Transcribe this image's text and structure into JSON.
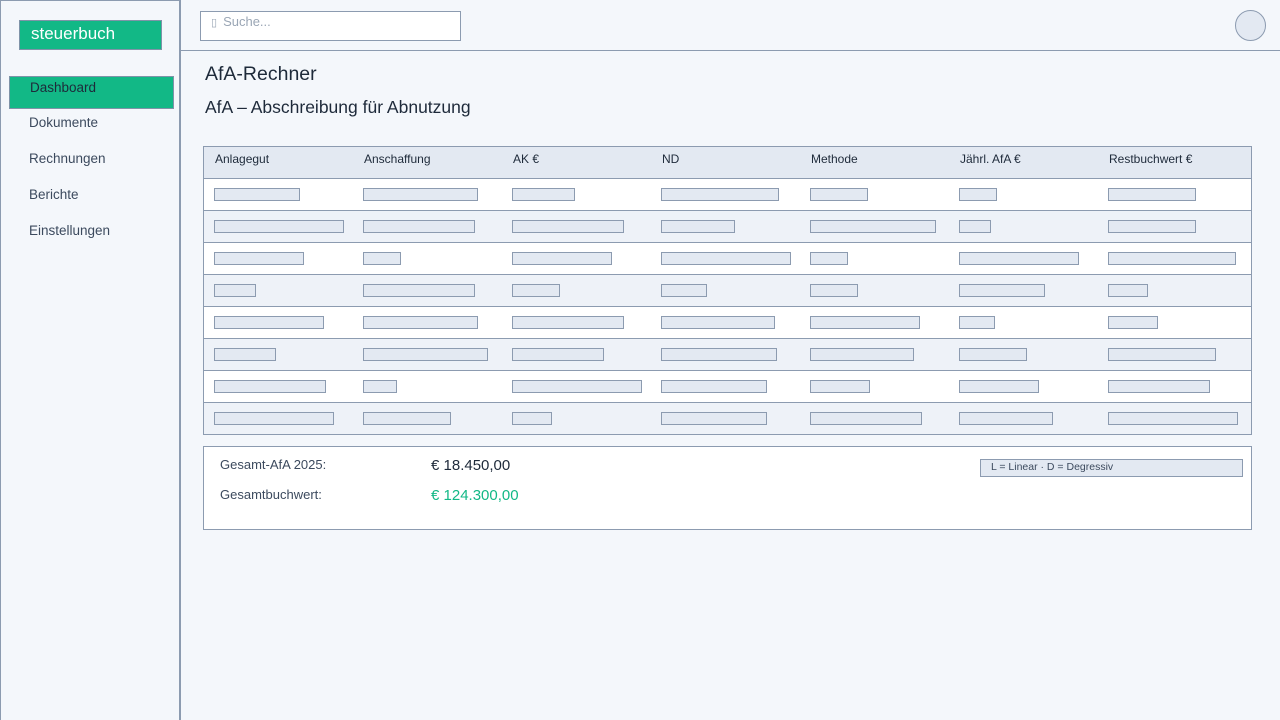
{
  "app": {
    "brand": "steuerbuch"
  },
  "sidebar": {
    "items": [
      {
        "label": "Dashboard",
        "active": true
      },
      {
        "label": "Dokumente"
      },
      {
        "label": "Rechnungen"
      },
      {
        "label": "Berichte"
      },
      {
        "label": "Einstellungen"
      }
    ]
  },
  "header": {
    "search_placeholder": "Suche...",
    "search_icon": "search-icon"
  },
  "page": {
    "title": "AfA-Rechner",
    "subtitle": "AfA – Abschreibung für Abnutzung"
  },
  "table": {
    "columns": [
      "Anlagegut",
      "Anschaffung",
      "AK €",
      "ND",
      "Methode",
      "Jährl. AfA €",
      "Restbuchwert €"
    ]
  },
  "summary": {
    "total_afa_label": "Gesamt-AfA 2025:",
    "total_afa_value": "€ 18.450,00",
    "book_value_label": "Gesamtbuchwert:",
    "book_value_value": "€ 124.300,00",
    "legend": "L = Linear  ·  D = Degressiv"
  },
  "colors": {
    "accent": "#12b886",
    "border": "#8c9bb0",
    "placeholder_fill": "#e3e9f2"
  }
}
